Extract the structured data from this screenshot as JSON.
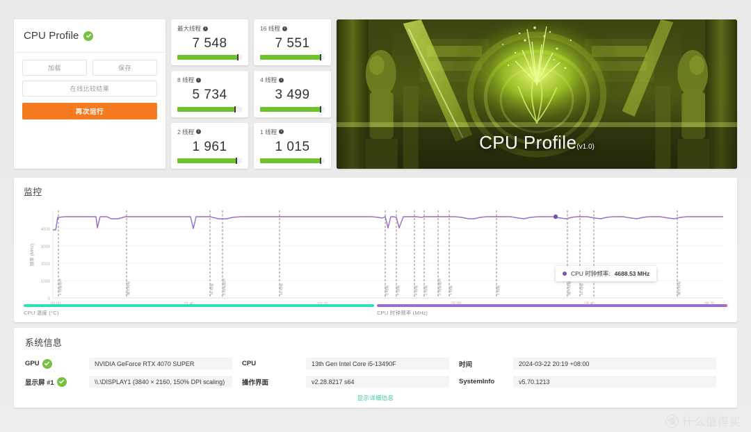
{
  "left_panel": {
    "title": "CPU Profile",
    "status_icon": "check-circle-icon",
    "buttons": {
      "load": "加载",
      "save": "保存",
      "compare_online": "在线比较结果",
      "run_again": "再次运行"
    }
  },
  "scores": [
    {
      "label": "最大线程",
      "value": "7 548",
      "percent": 93
    },
    {
      "label": "16 线程",
      "value": "7 551",
      "percent": 93
    },
    {
      "label": "8 线程",
      "value": "5 734",
      "percent": 88
    },
    {
      "label": "4 线程",
      "value": "3 499",
      "percent": 92
    },
    {
      "label": "2 线程",
      "value": "1 961",
      "percent": 90
    },
    {
      "label": "1 线程",
      "value": "1 015",
      "percent": 93
    }
  ],
  "hero": {
    "title": "CPU Profile",
    "version": "(v1.0)"
  },
  "monitor": {
    "title": "监控",
    "tooltip": {
      "series": "CPU 时钟频率:",
      "value": "4688.53 MHz"
    },
    "legend": [
      {
        "label": "CPU 温度 (°C)",
        "color": "#2ce0b0"
      },
      {
        "label": "CPU 时钟频率 (MHz)",
        "color": "#9b6fc7"
      }
    ]
  },
  "chart_data": {
    "type": "line",
    "title": "监控",
    "xlabel": "",
    "ylabel": "频率 (MHz)",
    "ylim": [
      0,
      5000
    ],
    "yticks": [
      0,
      1000,
      2000,
      3000,
      4000
    ],
    "xticks": [
      "00:00",
      "01:40",
      "03:20",
      "05:00",
      "06:40",
      "08:20"
    ],
    "grid": true,
    "legend_position": "bottom",
    "series": [
      {
        "name": "CPU 时钟频率 (MHz)",
        "color": "#9b6fc7",
        "unit": "MHz",
        "x": [
          0,
          2,
          5,
          8,
          12,
          14,
          16,
          20,
          24,
          28,
          32,
          36,
          40,
          44,
          48,
          52,
          56,
          60,
          64,
          68,
          72,
          76,
          80,
          84,
          88,
          92,
          96,
          100
        ],
        "values": [
          4180,
          4700,
          4700,
          4210,
          4700,
          4660,
          4700,
          4700,
          4180,
          4700,
          4660,
          4700,
          4700,
          4230,
          4700,
          4700,
          4180,
          4700,
          4700,
          4640,
          4700,
          4620,
          4700,
          4640,
          4700,
          4660,
          4700,
          4700
        ]
      },
      {
        "name": "CPU 温度 (°C)",
        "color": "#2ce0b0",
        "unit": "°C",
        "x": [],
        "values": []
      }
    ],
    "annotations": [
      {
        "x": "00:04",
        "label": "1 线程循环"
      },
      {
        "x": "00:52",
        "label": "最大线程"
      },
      {
        "x": "02:13",
        "label": "16 线程"
      },
      {
        "x": "02:22",
        "label": "8 线程循环"
      },
      {
        "x": "03:45",
        "label": "16 线程"
      },
      {
        "x": "04:46",
        "label": "8 线程"
      },
      {
        "x": "04:56",
        "label": "4 线程"
      },
      {
        "x": "05:18",
        "label": "4 线程"
      },
      {
        "x": "05:36",
        "label": "2 线程"
      },
      {
        "x": "05:52",
        "label": "2 线程循环"
      },
      {
        "x": "06:30",
        "label": "1 线程"
      },
      {
        "x": "07:42",
        "label": "1 线程"
      },
      {
        "x": "07:56",
        "label": "最大线程"
      },
      {
        "x": "08:40",
        "label": "最大线程"
      }
    ],
    "highlight_point": {
      "label": "CPU 时钟频率:",
      "value": 4688.53,
      "unit": "MHz"
    }
  },
  "sysinfo": {
    "title": "系统信息",
    "rows": [
      {
        "key": "GPU",
        "badge": true,
        "value": "NVIDIA GeForce RTX 4070 SUPER"
      },
      {
        "key": "CPU",
        "badge": false,
        "value": "13th Gen Intel Core i5-13490F"
      },
      {
        "key": "时间",
        "badge": false,
        "value": "2024-03-22 20:19 +08:00"
      },
      {
        "key": "显示屏 #1",
        "badge": true,
        "value": "\\\\.\\DISPLAY1 (3840 × 2160, 150% DPI scaling)"
      },
      {
        "key": "操作界面",
        "badge": false,
        "value": "v2.28.8217 s64"
      },
      {
        "key": "SystemInfo",
        "badge": false,
        "value": "v5.70.1213"
      }
    ],
    "details_link": "显示详细信息"
  },
  "watermark": {
    "logo": "值",
    "text": "什么值得买"
  },
  "colors": {
    "accent_orange": "#f47b20",
    "bar_green": "#6ec22e",
    "line_purple": "#9b6fc7",
    "temp_teal": "#2ce0b0",
    "link_teal": "#3fc2a7"
  }
}
